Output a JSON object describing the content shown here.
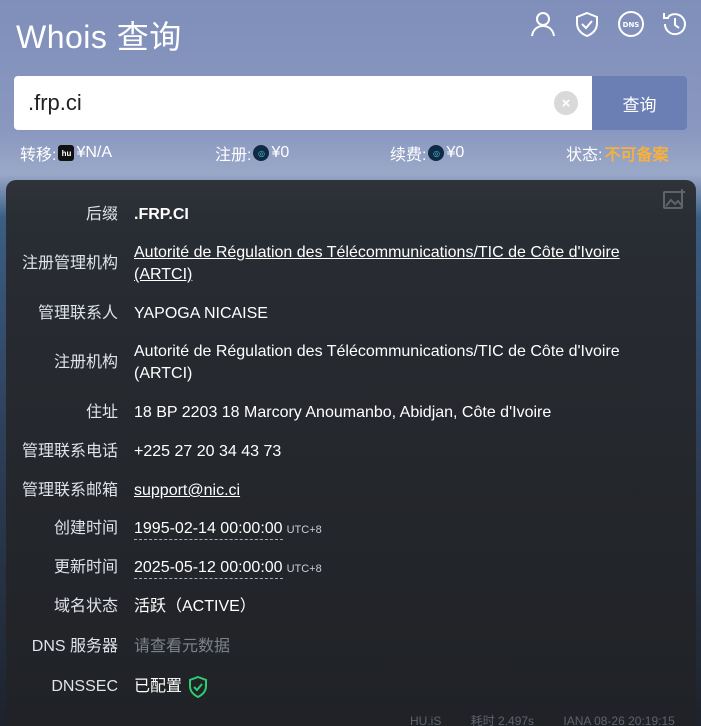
{
  "header": {
    "title": "Whois 查询",
    "icons": [
      "user-icon",
      "shield-icon",
      "dns-icon",
      "history-icon"
    ]
  },
  "search": {
    "value": ".frp.ci",
    "button_label": "查询"
  },
  "prices": {
    "transfer_label": "转移:",
    "transfer_value": "¥N/A",
    "register_label": "注册:",
    "register_value": "¥0",
    "renew_label": "续费:",
    "renew_value": "¥0",
    "status_label": "状态:",
    "status_value": "不可备案"
  },
  "details": {
    "suffix_label": "后缀",
    "suffix_value": ".FRP.CI",
    "registry_label": "注册管理机构",
    "registry_value": "Autorité de Régulation des Télécommunications/TIC de Côte d'Ivoire (ARTCI)",
    "admin_label": "管理联系人",
    "admin_value": "YAPOGA NICAISE",
    "registrar_label": "注册机构",
    "registrar_value": "Autorité de Régulation des Télécommunications/TIC de Côte d'Ivoire (ARTCI)",
    "address_label": "住址",
    "address_value": "18 BP 2203 18 Marcory Anoumanbo, Abidjan, Côte d'Ivoire",
    "phone_label": "管理联系电话",
    "phone_value": "+225 27 20 34 43 73",
    "email_label": "管理联系邮箱",
    "email_value": "support@nic.ci",
    "created_label": "创建时间",
    "created_value": "1995-02-14 00:00:00",
    "created_tz": "UTC+8",
    "updated_label": "更新时间",
    "updated_value": "2025-05-12 00:00:00",
    "updated_tz": "UTC+8",
    "status_label": "域名状态",
    "status_value": "活跃（ACTIVE）",
    "dns_label": "DNS 服务器",
    "dns_value": "请查看元数据",
    "dnssec_label": "DNSSEC",
    "dnssec_value": "已配置"
  },
  "footer": {
    "source": "HU.iS",
    "elapsed": "耗时 2.497s",
    "iana": "IANA 08-26 20:19:15"
  },
  "colors": {
    "accent": "#6b7fb5",
    "status_warn": "#f6b13d",
    "dnssec_ok": "#2ecc71"
  }
}
